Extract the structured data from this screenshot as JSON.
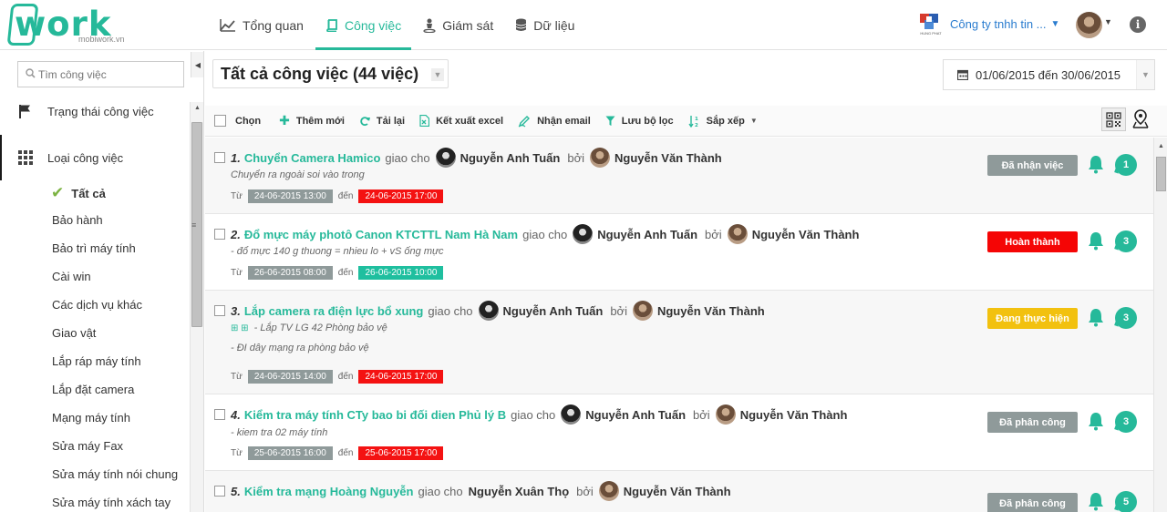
{
  "brand": {
    "word": "work",
    "sub": "mobiwork.vn",
    "accent": "#26b99a"
  },
  "nav": [
    {
      "label": "Tổng quan",
      "icon": "chart-icon"
    },
    {
      "label": "Công việc",
      "icon": "book-icon",
      "active": true
    },
    {
      "label": "Giám sát",
      "icon": "person-pin-icon"
    },
    {
      "label": "Dữ liệu",
      "icon": "database-icon"
    }
  ],
  "company": {
    "name": "Công ty tnhh tin ...",
    "logo_text": "HUNG PHAT"
  },
  "sidebar": {
    "search_placeholder": "Tìm công việc",
    "sections": [
      {
        "label": "Trạng thái công việc",
        "icon": "flag-icon"
      },
      {
        "label": "Loại công việc",
        "icon": "grid-icon"
      }
    ],
    "all_label": "Tất cả",
    "items": [
      "Bảo hành",
      "Bảo trì máy tính",
      "Cài win",
      "Các dịch vụ khác",
      "Giao vật",
      "Lắp ráp máy tính",
      "Lắp đặt camera",
      "Mạng máy tính",
      "Sửa máy Fax",
      "Sửa máy tính nói chung",
      "Sửa máy tính xách tay"
    ]
  },
  "main": {
    "title": "Tất cả công việc (44 việc)",
    "date_range": "01/06/2015 đến 30/06/2015"
  },
  "toolbar": {
    "select": "Chọn",
    "add": "Thêm mới",
    "reload": "Tải lại",
    "export": "Kết xuất excel",
    "email": "Nhận email",
    "save_filter": "Lưu bộ lọc",
    "sort": "Sắp xếp"
  },
  "labels": {
    "assigned_to": "giao cho",
    "by": "bởi",
    "from": "Từ",
    "to": "đến"
  },
  "tasks": [
    {
      "num": "1.",
      "name": "Chuyển Camera Hamico",
      "assignee": "Nguyễn Anh Tuấn",
      "assigner": "Nguyễn Văn Thành",
      "desc": [
        "Chuyển ra ngoài soi vào trong"
      ],
      "start": "24-06-2015 13:00",
      "end": "24-06-2015 17:00",
      "end_color": "red",
      "status": "Đã nhận việc",
      "status_color": "gray",
      "comments": "1"
    },
    {
      "num": "2.",
      "name": "Đổ mực máy photô Canon KTCTTL Nam Hà Nam",
      "assignee": "Nguyễn Anh Tuấn",
      "assigner": "Nguyễn Văn Thành",
      "desc": [
        "- đổ mực 140 g thuong = nhieu lo + vS ống mực"
      ],
      "start": "26-06-2015 08:00",
      "end": "26-06-2015 10:00",
      "end_color": "teal",
      "status": "Hoàn thành",
      "status_color": "red",
      "comments": "3"
    },
    {
      "num": "3.",
      "name": "Lắp camera ra điện lực bổ xung",
      "assignee": "Nguyễn Anh Tuấn",
      "assigner": "Nguyễn Văn Thành",
      "desc": [
        "- Lắp TV LG 42 Phòng bảo vệ",
        "- ĐI dây mạng ra phòng bảo vệ"
      ],
      "start": "24-06-2015 14:00",
      "end": "24-06-2015 17:00",
      "end_color": "red",
      "status": "Đang thực hiện",
      "status_color": "yellow",
      "comments": "3"
    },
    {
      "num": "4.",
      "name": "Kiểm tra máy tính CTy bao bi đối dien Phủ lý B",
      "assignee": "Nguyễn Anh Tuấn",
      "assigner": "Nguyễn Văn Thành",
      "desc": [
        "- kiem tra 02 máy tính"
      ],
      "start": "25-06-2015 16:00",
      "end": "25-06-2015 17:00",
      "end_color": "red",
      "status": "Đã phân công",
      "status_color": "gray",
      "comments": "3"
    },
    {
      "num": "5.",
      "name": "Kiểm tra mạng Hoàng Nguyễn",
      "assignee": "Nguyễn Xuân Thọ",
      "assigner": "Nguyễn Văn Thành",
      "desc": [],
      "start": "",
      "end": "",
      "end_color": "red",
      "status": "Đã phân công",
      "status_color": "gray",
      "comments": "5"
    }
  ]
}
